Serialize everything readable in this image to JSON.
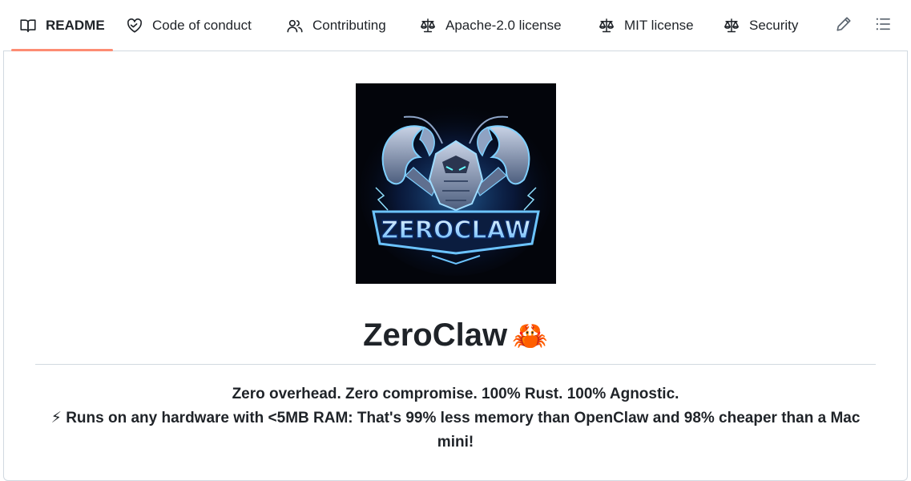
{
  "tabs": [
    {
      "label": "README",
      "icon": "book-icon",
      "active": true
    },
    {
      "label": "Code of conduct",
      "icon": "code-of-conduct-icon",
      "active": false
    },
    {
      "label": "Contributing",
      "icon": "people-icon",
      "active": false
    },
    {
      "label": "Apache-2.0 license",
      "icon": "law-icon",
      "active": false
    },
    {
      "label": "MIT license",
      "icon": "law-icon",
      "active": false
    },
    {
      "label": "Security",
      "icon": "law-icon",
      "active": false
    }
  ],
  "toolbar": {
    "edit_icon": "pencil-icon",
    "outline_icon": "list-unordered-icon"
  },
  "readme": {
    "logo_text": "ZEROCLAW",
    "title": "ZeroClaw",
    "title_emoji": "🦀",
    "tagline_line1": "Zero overhead. Zero compromise. 100% Rust. 100% Agnostic.",
    "tagline_line2": "⚡ Runs on any hardware with <5MB RAM: That's 99% less memory than OpenClaw and 98% cheaper than a Mac mini!"
  },
  "colors": {
    "active_tab_underline": "#fd8c73",
    "border": "#d1d9e0",
    "text": "#1f2328",
    "logo_background": "#03050b",
    "logo_glow": "#3fa9ff"
  }
}
